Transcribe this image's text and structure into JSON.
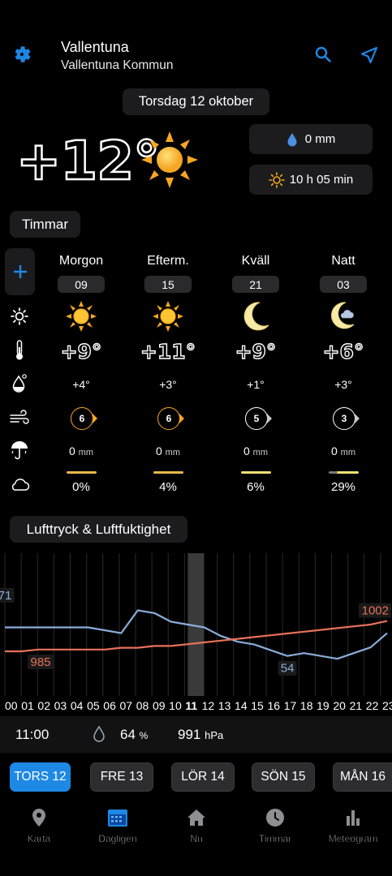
{
  "location": {
    "name": "Vallentuna",
    "municipality": "Vallentuna Kommun"
  },
  "date_label": "Torsdag 12 oktober",
  "current": {
    "temp": "+12°",
    "precip": "0 mm",
    "daylight": "10 h 05 min"
  },
  "section_hours": "Timmar",
  "periods": [
    {
      "name": "Morgon",
      "hour": "09",
      "icon": "sun-icon",
      "temp": "+9°",
      "feels": "+4°",
      "wind": "6",
      "rain_val": "0",
      "rain_unit": "mm",
      "cloud_pct": "0%",
      "cloud_fraction": 0.0
    },
    {
      "name": "Efterm.",
      "hour": "15",
      "icon": "sun-icon",
      "temp": "+11°",
      "feels": "+3°",
      "wind": "6",
      "rain_val": "0",
      "rain_unit": "mm",
      "cloud_pct": "4%",
      "cloud_fraction": 0.04
    },
    {
      "name": "Kväll",
      "hour": "21",
      "icon": "moon-icon",
      "temp": "+9°",
      "feels": "+1°",
      "wind": "5",
      "rain_val": "0",
      "rain_unit": "mm",
      "cloud_pct": "6%",
      "cloud_fraction": 0.06
    },
    {
      "name": "Natt",
      "hour": "03",
      "icon": "moon-cloud-icon",
      "temp": "+6°",
      "feels": "+3°",
      "wind": "3",
      "rain_val": "0",
      "rain_unit": "mm",
      "cloud_pct": "29%",
      "cloud_fraction": 0.29
    }
  ],
  "section_pressure": "Lufttryck & Luftfuktighet",
  "chart_data": {
    "type": "line",
    "x": [
      "00",
      "01",
      "02",
      "03",
      "04",
      "05",
      "06",
      "07",
      "08",
      "09",
      "10",
      "11",
      "12",
      "13",
      "14",
      "15",
      "16",
      "17",
      "18",
      "19",
      "20",
      "21",
      "22",
      "23"
    ],
    "selected_hour": "11",
    "series": [
      {
        "values": [
          64,
          64,
          64,
          64,
          64,
          64,
          63,
          62,
          70,
          69,
          66,
          65,
          64,
          61,
          59,
          58,
          56,
          54,
          55,
          54,
          53,
          55,
          57,
          62
        ],
        "color": "#8aaedb"
      },
      {
        "values": [
          985,
          985,
          986,
          986,
          986,
          986,
          986,
          987,
          987,
          988,
          988,
          989,
          990,
          991,
          992,
          993,
          994,
          995,
          996,
          997,
          998,
          999,
          1000,
          1002
        ],
        "color": "#e8715a"
      }
    ],
    "labels": [
      {
        "series": 0,
        "text": "71"
      },
      {
        "series": 0,
        "text": "54"
      },
      {
        "series": 1,
        "text": "985"
      },
      {
        "series": 1,
        "text": "1002"
      }
    ]
  },
  "readout": {
    "time": "11:00",
    "humidity": "64",
    "humidity_unit": "%",
    "pressure": "991",
    "pressure_unit": "hPa"
  },
  "days": [
    {
      "label": "TORS 12",
      "active": true
    },
    {
      "label": "FRE  13",
      "active": false
    },
    {
      "label": "LÖR  14",
      "active": false
    },
    {
      "label": "SÖN  15",
      "active": false
    },
    {
      "label": "MÅN  16",
      "active": false
    }
  ],
  "nav": [
    {
      "label": "Karta",
      "icon": "map-pin-icon"
    },
    {
      "label": "Dagligen",
      "icon": "calendar-icon"
    },
    {
      "label": "Nu",
      "icon": "home-icon"
    },
    {
      "label": "Timmar",
      "icon": "clock-icon"
    },
    {
      "label": "Meteogram",
      "icon": "bar-chart-icon"
    }
  ],
  "colors": {
    "accent": "#1e88e5",
    "sun": "#f5a623",
    "humidity_line": "#8aaedb",
    "pressure_line": "#e8715a"
  }
}
